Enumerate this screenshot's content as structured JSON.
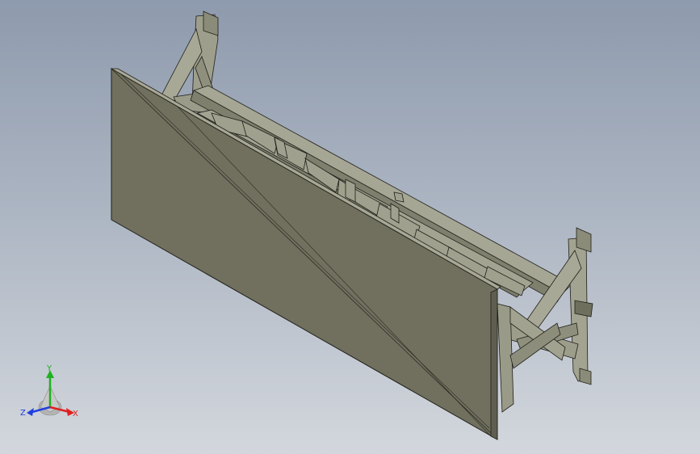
{
  "viewport": {
    "background_top": "#8e9aad",
    "background_bottom": "#d3d7dd"
  },
  "model": {
    "face_color": "#71705f",
    "frame_color": "#a3a391",
    "frame_shade": "#7f7f6e",
    "edge_color": "#1f1f19"
  },
  "triad": {
    "x_label": "X",
    "y_label": "Y",
    "z_label": "Z",
    "x_color": "#e02020",
    "y_color": "#20b020",
    "z_color": "#2040e0"
  }
}
